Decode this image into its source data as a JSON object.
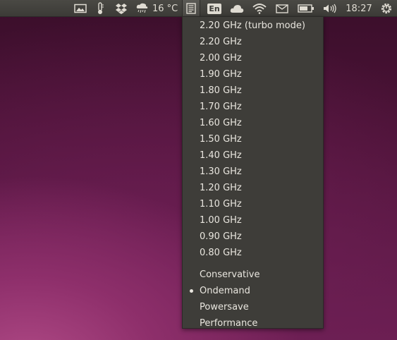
{
  "panel": {
    "weather_temp": "16 °C",
    "keyboard_layout": "En",
    "clock": "18:27",
    "icons": {
      "screenshot": "screen-icon",
      "thermometer": "thermometer-icon",
      "dropbox": "dropbox-icon",
      "weather": "weather-rain-icon",
      "cpufreq": "cpufreq-indicator-icon",
      "cloud": "cloud-icon",
      "wifi": "wifi-icon",
      "mail": "mail-icon",
      "battery": "battery-icon",
      "volume": "volume-icon",
      "session": "gear-power-icon"
    }
  },
  "menu": {
    "frequencies": [
      "2.20 GHz (turbo mode)",
      "2.20 GHz",
      "2.00 GHz",
      "1.90 GHz",
      "1.80 GHz",
      "1.70 GHz",
      "1.60 GHz",
      "1.50 GHz",
      "1.40 GHz",
      "1.30 GHz",
      "1.20 GHz",
      "1.10 GHz",
      "1.00 GHz",
      "0.90 GHz",
      "0.80 GHz"
    ],
    "governors": [
      "Conservative",
      "Ondemand",
      "Powersave",
      "Performance"
    ],
    "selected_governor": "Ondemand"
  },
  "colors": {
    "panel_bg": "#3c3b37",
    "menu_bg": "#3e3d39",
    "menu_text": "#e9e6df"
  }
}
